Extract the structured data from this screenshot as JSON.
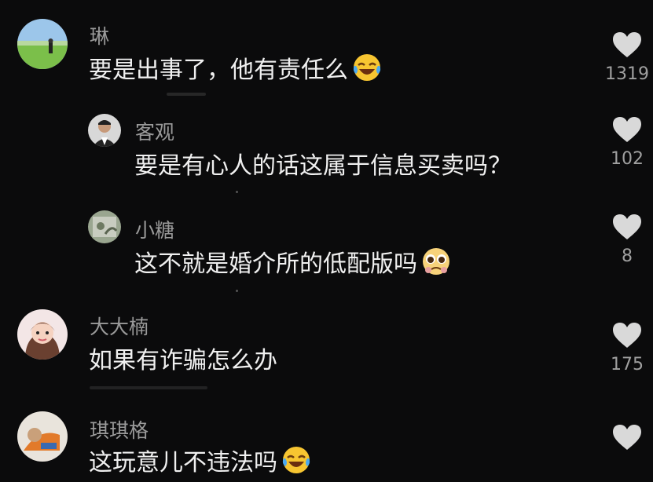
{
  "comments": [
    {
      "username": "琳",
      "text": "要是出事了，他有责任么",
      "emoji": "laughing-crying-emoji",
      "likes": "1319"
    },
    {
      "username": "客观",
      "text": "要是有心人的话这属于信息买卖吗？",
      "likes": "102"
    },
    {
      "username": "小糖",
      "text": "这不就是婚介所的低配版吗",
      "emoji": "pleading-emoji",
      "likes": "8"
    },
    {
      "username": "大大楠",
      "text": "如果有诈骗怎么办",
      "likes": "175"
    },
    {
      "username": "琪琪格",
      "text": "这玩意儿不违法吗",
      "emoji": "laughing-crying-emoji",
      "likes": ""
    }
  ],
  "colors": {
    "background": "#0b0b0c",
    "username": "#9a9a9a",
    "text": "#f0f0f0",
    "heart": "#d9d9d9"
  }
}
